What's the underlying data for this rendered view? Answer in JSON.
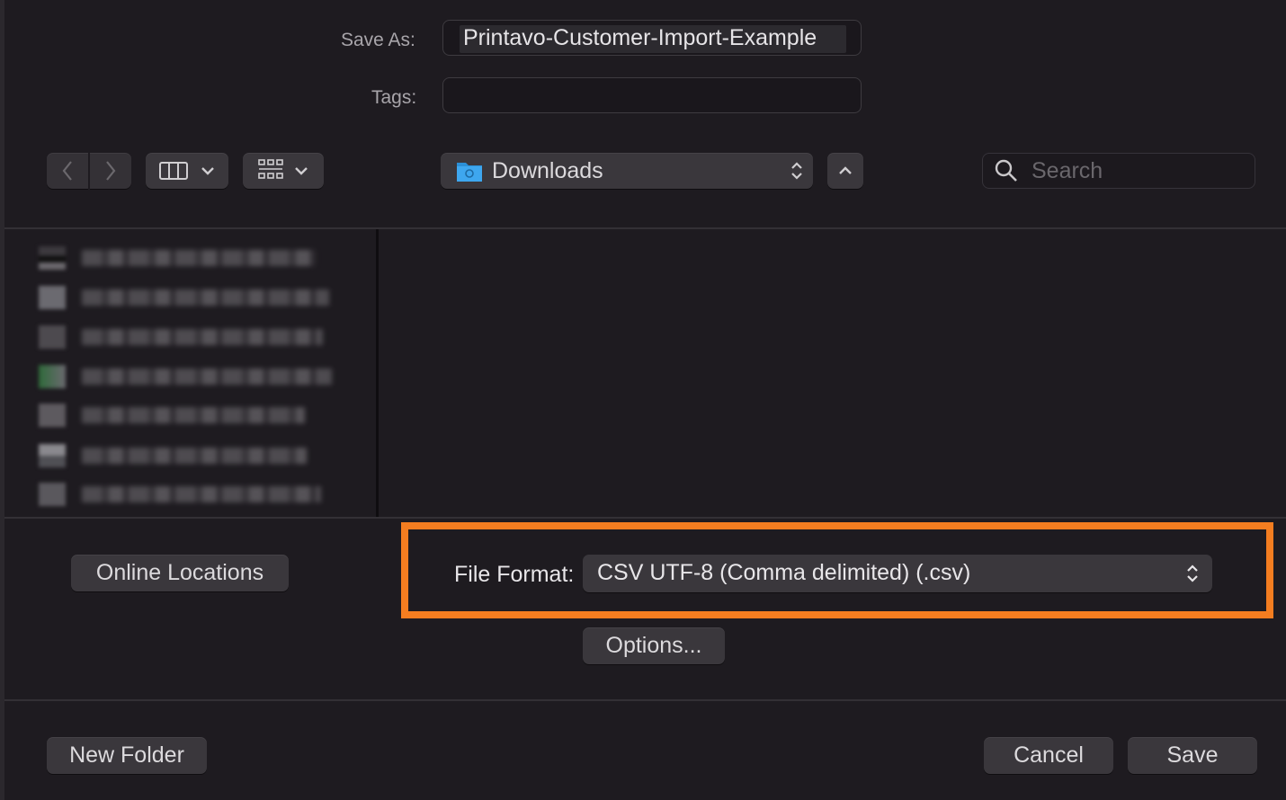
{
  "save_as": {
    "label": "Save As:",
    "value": "Printavo-Customer-Import-Example"
  },
  "tags": {
    "label": "Tags:",
    "value": ""
  },
  "toolbar": {
    "location": "Downloads",
    "search_placeholder": "Search"
  },
  "sidebar": {
    "online_locations_label": "Online Locations"
  },
  "file_format": {
    "label": "File Format:",
    "value": "CSV UTF-8 (Comma delimited) (.csv)",
    "highlight_color": "#f47d20"
  },
  "options_label": "Options...",
  "footer": {
    "new_folder_label": "New Folder",
    "cancel_label": "Cancel",
    "save_label": "Save"
  }
}
